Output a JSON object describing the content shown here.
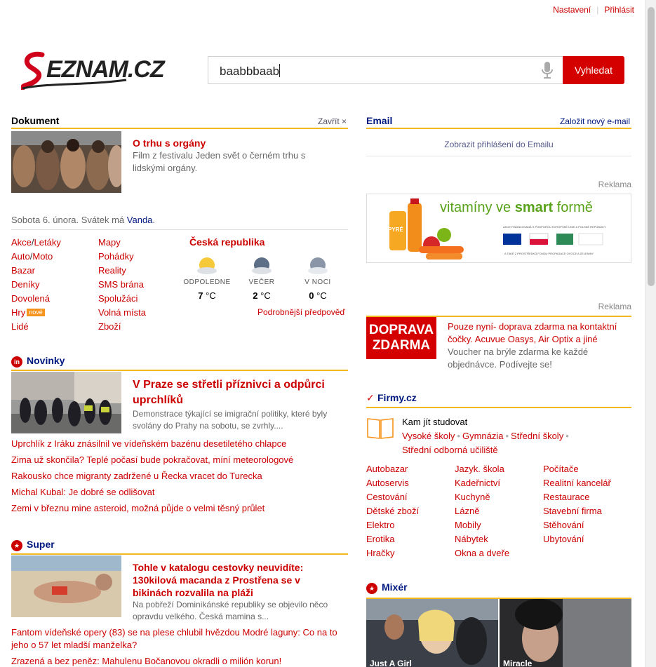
{
  "topnav": {
    "settings": "Nastavení",
    "login": "Přihlásit"
  },
  "search": {
    "value": "baabbbaab",
    "button": "Vyhledat"
  },
  "dokument": {
    "header": "Dokument",
    "close": "Zavřít ×",
    "title": "O trhu s orgány",
    "desc": "Film z festivalu Jeden svět o černém trhu s lidskými orgány."
  },
  "date": {
    "text": "Sobota 6. února. Svátek má ",
    "name": "Vanda",
    "end": "."
  },
  "services": {
    "col1": [
      "Akce",
      "Letáky",
      "Auto",
      "Moto",
      "Bazar",
      "Deníky",
      "Dovolená",
      "Hry",
      "Lidé"
    ],
    "new_badge": "nové",
    "col2": [
      "Mapy",
      "Pohádky",
      "Reality",
      "SMS brána",
      "Spolužáci",
      "Volná místa",
      "Zboží"
    ]
  },
  "weather": {
    "title": "Česká republika",
    "items": [
      {
        "label": "ODPOLEDNE",
        "temp": "7",
        "unit": "°C"
      },
      {
        "label": "VEČER",
        "temp": "2",
        "unit": "°C"
      },
      {
        "label": "V NOCI",
        "temp": "0",
        "unit": "°C"
      }
    ],
    "more": "Podrobnější předpověď"
  },
  "novinky": {
    "header": "Novinky",
    "title": "V Praze se střetli příznivci a odpůrci uprchlíků",
    "desc": "Demonstrace týkající se imigrační politiky, které byly svolány do Prahy na sobotu, se zvrhly....",
    "links": [
      "Uprchlík z Iráku znásilnil ve vídeňském bazénu desetiletého chlapce",
      "Zima už skončila? Teplé počasí bude pokračovat, míní meteorologové",
      "Rakousko chce migranty zadržené u Řecka vracet do Turecka",
      "Michal Kubal: Je dobré se odlišovat",
      "Zemi v březnu mine asteroid, možná půjde o velmi těsný průlet"
    ]
  },
  "super": {
    "header": "Super",
    "title": "Tohle v katalogu cestovky neuvidíte: 130kilová macanda z Prostřena se v bikinách rozvalila na pláži",
    "desc": "Na pobřeží Dominikánské republiky se objevilo něco opravdu velkého. Česká mamina s...",
    "links": [
      "Fantom vídeňské opery (83) se na plese chlubil hvězdou Modré laguny: Co na to jeho o 57 let mladší manželka?",
      "Zrazená a bez peněz: Mahulenu Bočanovou okradli o milión korun!"
    ]
  },
  "email": {
    "header": "Email",
    "new": "Založit nový e-mail",
    "show": "Zobrazit přihlášení do Emailu"
  },
  "ads": {
    "label": "Reklama",
    "ad1_text_a": "vitamíny ve ",
    "ad1_text_b": "smart",
    "ad1_text_c": " formě",
    "ad1_small": "AKCE FINANCOVANÁ S PODPOROU EVROPSKÉ UNIE A POLSKÉ REPUBLIKY",
    "ad1_small2": "A TAKÉ Z PROSTŘEDKŮ FONDU PROPAGACE OVOCE A ZELENINY",
    "ad1_pack": "PYRÉ",
    "ad2_box": "DOPRAVA ZDARMA",
    "ad2_title": "Pouze nyní- doprava zdarma na kontaktní čočky. Acuvue Oasys, Air Optix a jiné",
    "ad2_desc": "Voucher na brýle zdarma ke každé objednávce. Podívejte se!"
  },
  "firmy": {
    "header": "Firmy.cz",
    "study": "Kam jít studovat",
    "study_links": [
      "Vysoké školy",
      "Gymnázia",
      "Střední školy",
      "Střední odborná učiliště"
    ],
    "col1": [
      "Autobazar",
      "Autoservis",
      "Cestování",
      "Dětské zboží",
      "Elektro",
      "Erotika",
      "Hračky"
    ],
    "col2": [
      "Jazyk. škola",
      "Kadeřnictví",
      "Kuchyně",
      "Lázně",
      "Mobily",
      "Nábytek",
      "Okna a dveře"
    ],
    "col3": [
      "Počítače",
      "Realitní kancelář",
      "Restaurace",
      "Stavební firma",
      "Stěhování",
      "Ubytování"
    ]
  },
  "mixer": {
    "header": "Mixér",
    "video1": "Just A Girl",
    "video2": "Miracle"
  },
  "colors": {
    "accent": "#c00",
    "rule": "#f2b81c",
    "button": "#d40000"
  }
}
